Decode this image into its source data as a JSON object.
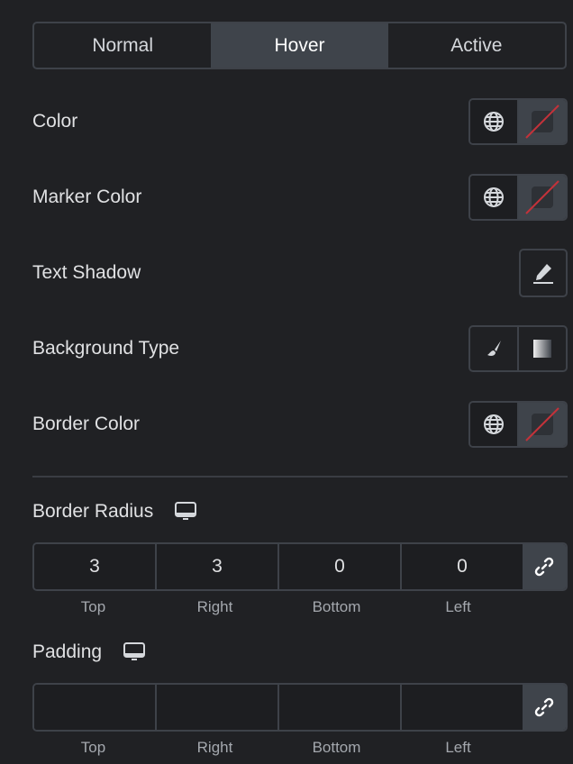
{
  "tabs": [
    {
      "label": "Normal",
      "active": false
    },
    {
      "label": "Hover",
      "active": true
    },
    {
      "label": "Active",
      "active": false
    }
  ],
  "controls": {
    "color": {
      "label": "Color"
    },
    "marker_color": {
      "label": "Marker Color"
    },
    "text_shadow": {
      "label": "Text Shadow"
    },
    "background_type": {
      "label": "Background Type"
    },
    "border_color": {
      "label": "Border Color"
    }
  },
  "border_radius": {
    "label": "Border Radius",
    "values": {
      "top": "3",
      "right": "3",
      "bottom": "0",
      "left": "0"
    },
    "sublabels": {
      "top": "Top",
      "right": "Right",
      "bottom": "Bottom",
      "left": "Left"
    }
  },
  "padding": {
    "label": "Padding",
    "values": {
      "top": "",
      "right": "",
      "bottom": "",
      "left": ""
    },
    "sublabels": {
      "top": "Top",
      "right": "Right",
      "bottom": "Bottom",
      "left": "Left"
    }
  },
  "colors": {
    "accent_none": "#c3323a",
    "active_tab": "#3f444b",
    "background": "#202124"
  }
}
